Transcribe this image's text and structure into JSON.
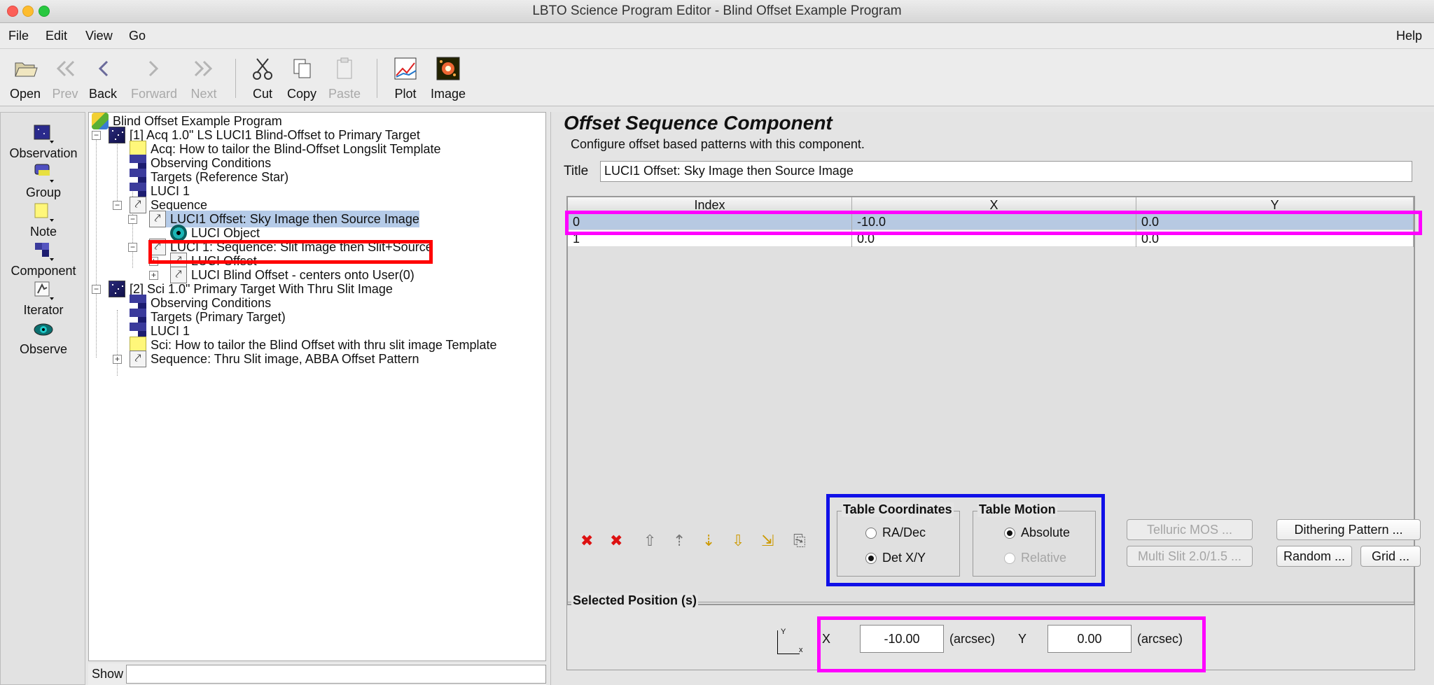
{
  "window": {
    "title": "LBTO Science Program Editor - Blind Offset Example Program"
  },
  "menu": {
    "file": "File",
    "edit": "Edit",
    "view": "View",
    "go": "Go",
    "help": "Help"
  },
  "toolbar": {
    "open": "Open",
    "prev": "Prev",
    "back": "Back",
    "forward": "Forward",
    "next": "Next",
    "cut": "Cut",
    "copy": "Copy",
    "paste": "Paste",
    "plot": "Plot",
    "image": "Image"
  },
  "palette": {
    "observation": "Observation",
    "group": "Group",
    "note": "Note",
    "component": "Component",
    "iterator": "Iterator",
    "observe": "Observe"
  },
  "tree": {
    "root": "Blind Offset Example Program",
    "n1": "[1] Acq 1.0\" LS LUCI1 Blind-Offset to Primary Target",
    "n1_note": "Acq: How to tailor the Blind-Offset Longslit Template",
    "n1_cond": "Observing Conditions",
    "n1_targets": "Targets (Reference Star)",
    "n1_luci": "LUCI 1",
    "n1_seq": "Sequence",
    "n1_offset": "LUCI1 Offset: Sky Image then Source Image",
    "n1_object": "LUCI Object",
    "n1_seq2": "LUCI 1: Sequence: Slit Image then Slit+Source",
    "n1_luci_offset": "LUCI Offset",
    "n1_blind": "LUCI Blind Offset - centers onto User(0)",
    "n2": "[2] Sci 1.0\" Primary Target With Thru Slit Image",
    "n2_cond": "Observing Conditions",
    "n2_targets": "Targets (Primary Target)",
    "n2_luci": "LUCI 1",
    "n2_note": "Sci: How to tailor the Blind Offset with thru slit image Template",
    "n2_seq": "Sequence: Thru Slit image, ABBA Offset Pattern"
  },
  "show": {
    "label": "Show"
  },
  "panel": {
    "title": "Offset Sequence Component",
    "description": "Configure offset based patterns with this component.",
    "title_label": "Title",
    "title_value": "LUCI1 Offset: Sky Image then Source Image"
  },
  "table": {
    "headers": {
      "index": "Index",
      "x": "X",
      "y": "Y"
    },
    "rows": [
      {
        "index": "0",
        "x": "-10.0",
        "y": "0.0"
      },
      {
        "index": "1",
        "x": "0.0",
        "y": "0.0"
      }
    ]
  },
  "coords": {
    "title": "Table Coordinates",
    "radec": "RA/Dec",
    "detxy": "Det X/Y",
    "selected": "Det X/Y"
  },
  "motion": {
    "title": "Table Motion",
    "absolute": "Absolute",
    "relative": "Relative",
    "selected": "Absolute"
  },
  "buttons": {
    "telluric": "Telluric MOS ...",
    "multislit": "Multi Slit 2.0/1.5 ...",
    "dithering": "Dithering Pattern ...",
    "random": "Random ...",
    "grid": "Grid ..."
  },
  "selected": {
    "title": "Selected Position (s)",
    "x_label": "X",
    "x_value": "-10.00",
    "x_unit": "(arcsec)",
    "y_label": "Y",
    "y_value": "0.00",
    "y_unit": "(arcsec)",
    "axis_y": "Y",
    "axis_x": "x"
  },
  "colors": {
    "highlight_red": "#ff0000",
    "highlight_magenta": "#ff00ff",
    "highlight_blue": "#1010e8",
    "selection": "#b7c9e2"
  }
}
